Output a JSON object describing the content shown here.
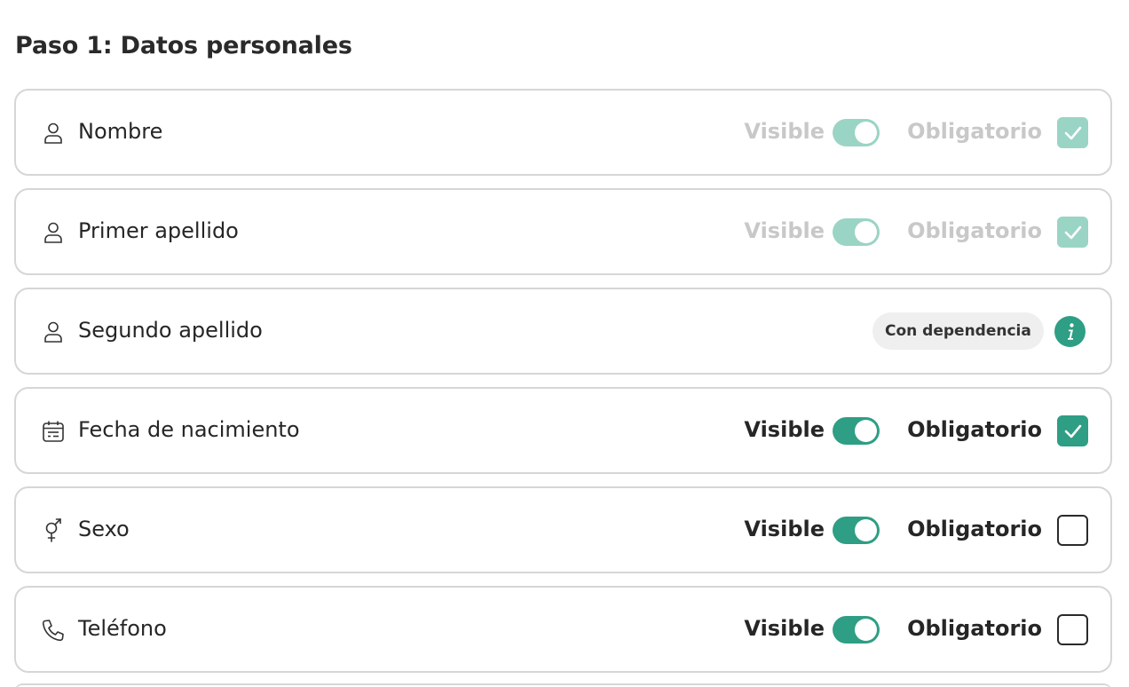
{
  "page": {
    "title": "Paso 1: Datos personales"
  },
  "colors": {
    "accent": "#2e9e84",
    "accent_disabled": "#9ad4c5",
    "disabled_text": "#c8c8c8",
    "border": "#d6d6d6"
  },
  "visible_label": "Visible",
  "required_label": "Obligatorio",
  "fields": [
    {
      "label": "Nombre",
      "icon": "user-icon",
      "state": "locked",
      "visible": true,
      "required": true
    },
    {
      "label": "Primer apellido",
      "icon": "user-icon",
      "state": "locked",
      "visible": true,
      "required": true
    },
    {
      "label": "Segundo apellido",
      "icon": "user-icon",
      "state": "dependency",
      "badge": "Con dependencia",
      "info_icon": "info-icon"
    },
    {
      "label": "Fecha de nacimiento",
      "icon": "calendar-icon",
      "state": "editable",
      "visible": true,
      "required": true
    },
    {
      "label": "Sexo",
      "icon": "gender-icon",
      "state": "editable",
      "visible": true,
      "required": false
    },
    {
      "label": "Teléfono",
      "icon": "phone-icon",
      "state": "editable",
      "visible": true,
      "required": false
    }
  ]
}
